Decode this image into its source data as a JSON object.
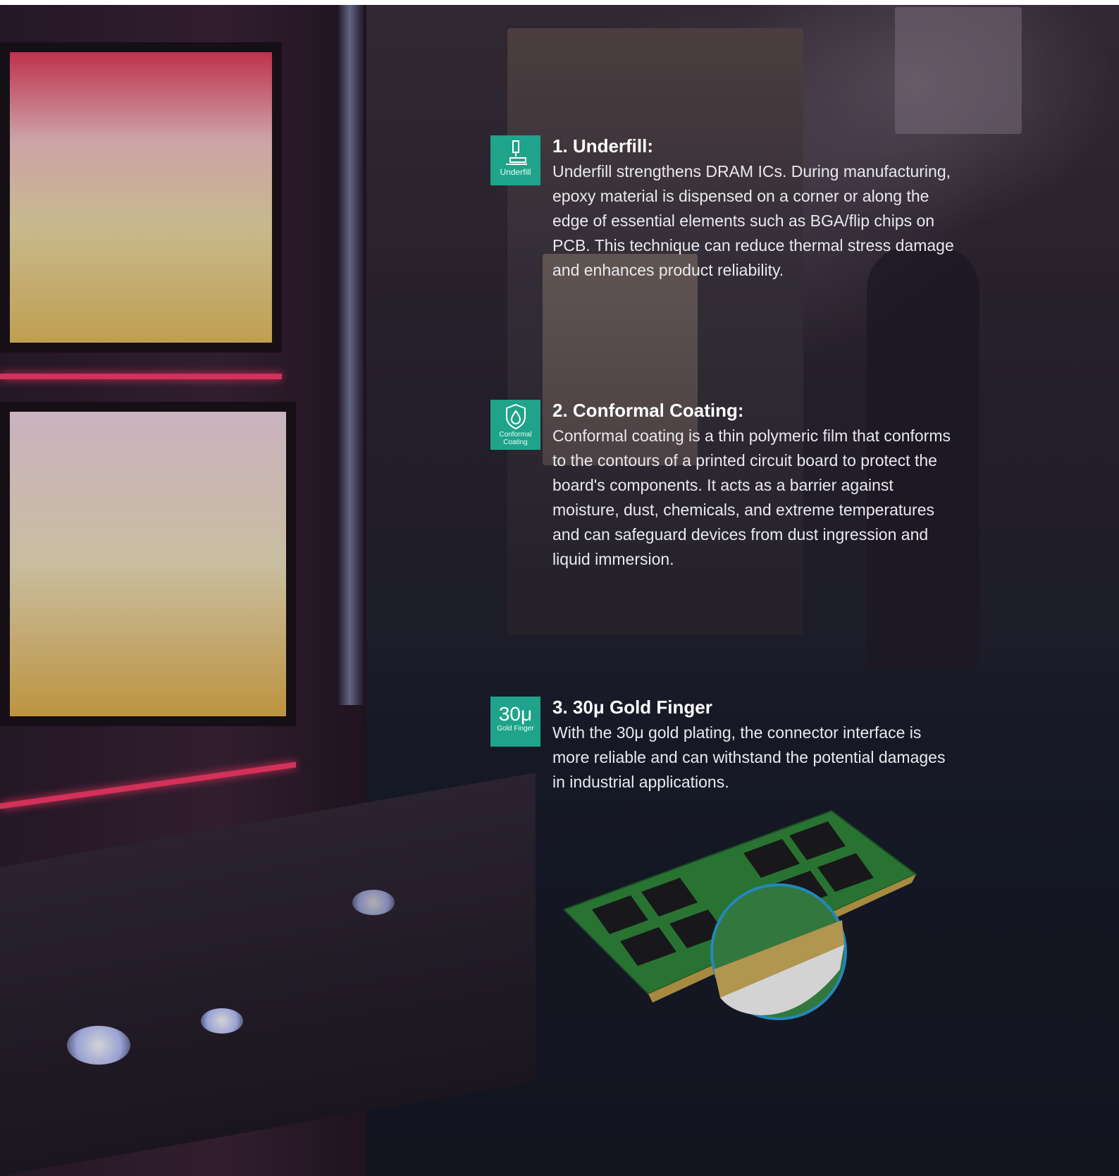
{
  "features": [
    {
      "icon": "syringe-chip-icon",
      "badge_label": "Underfill",
      "title": "1. Underfill:",
      "body": "Underfill strengthens DRAM ICs. During manufacturing, epoxy material is dispensed on a corner or along the edge of essential elements such as BGA/flip chips on PCB. This technique can reduce thermal stress damage and enhances product reliability."
    },
    {
      "icon": "shield-drop-icon",
      "badge_label_line1": "Conformal",
      "badge_label_line2": "Coating",
      "title": "2. Conformal Coating:",
      "body": "Conformal coating is a thin polymeric film that conforms to the contours of a printed circuit board to protect the board's components. It acts as a barrier against moisture, dust, chemicals, and extreme temperatures and can safeguard devices from dust ingression and liquid immersion."
    },
    {
      "badge_value": "30μ",
      "badge_label": "Gold Finger",
      "title": "3. 30μ Gold Finger",
      "body": "With the 30μ gold plating, the connector interface is more reliable and can withstand the potential damages in industrial applications."
    }
  ],
  "colors": {
    "badge": "#1fa38a",
    "title": "#ffffff",
    "body": "#e9e9ee",
    "ram_pcb": "#2f8a3a",
    "zoom_ring": "#2aa3e0"
  }
}
